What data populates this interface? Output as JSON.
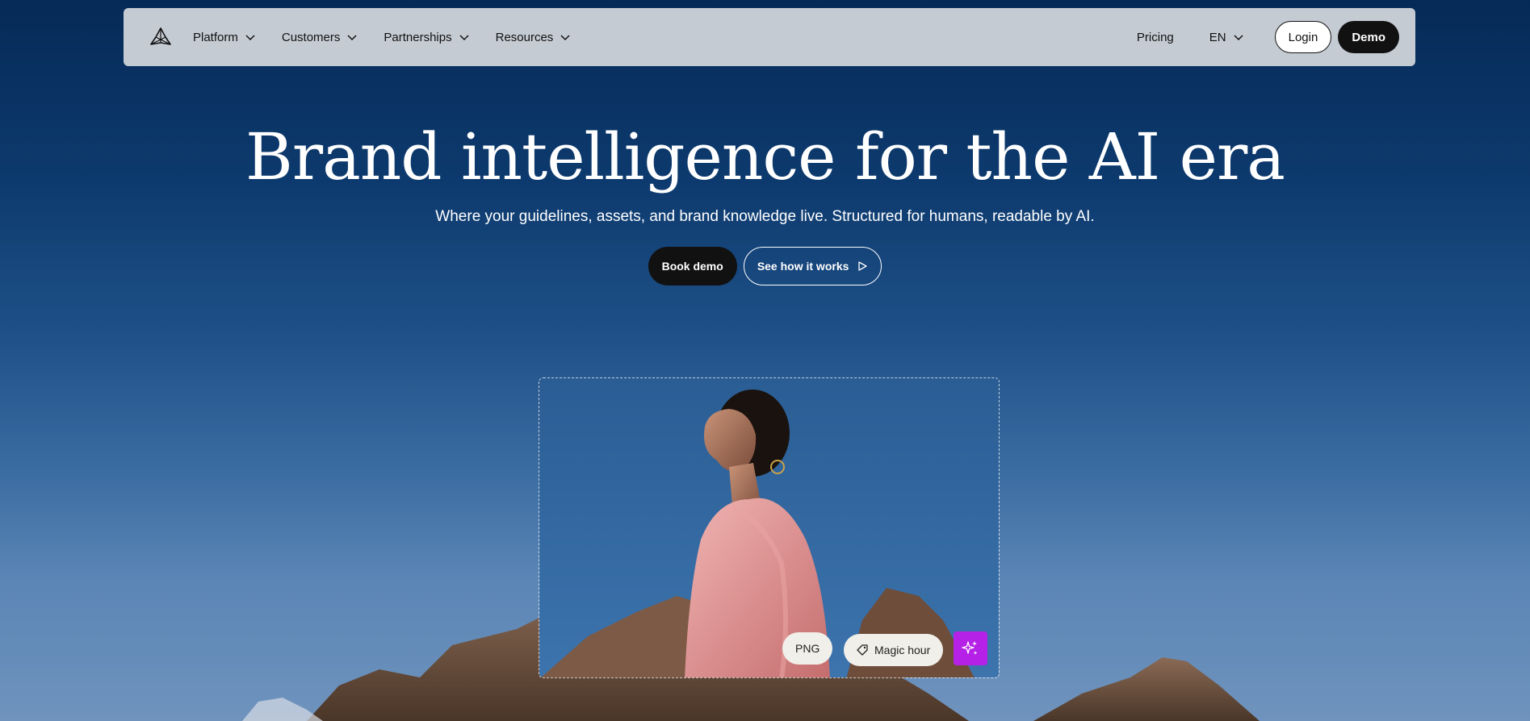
{
  "nav": {
    "logo_icon": "tri-blade-logo-icon",
    "items": [
      {
        "label": "Platform"
      },
      {
        "label": "Customers"
      },
      {
        "label": "Partnerships"
      },
      {
        "label": "Resources"
      }
    ],
    "pricing": "Pricing",
    "language": "EN",
    "login": "Login",
    "demo": "Demo"
  },
  "hero": {
    "title": "Brand intelligence for the AI era",
    "subtitle": "Where your guidelines, assets, and brand knowledge live. Structured for humans, readable by AI.",
    "book_demo": "Book demo",
    "see_how": "See how it works"
  },
  "card": {
    "tags": {
      "format": "PNG",
      "label": "Magic hour"
    },
    "ai_icon": "sparkles-icon",
    "ai_color": "#b521e6"
  }
}
